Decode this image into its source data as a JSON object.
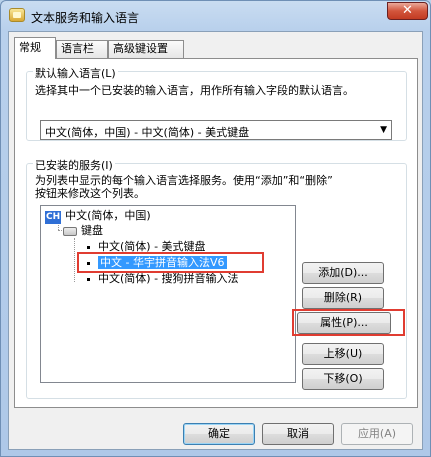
{
  "window": {
    "title": "文本服务和输入语言",
    "close_label": "✕"
  },
  "tabs": [
    {
      "label": "常规",
      "active": true
    },
    {
      "label": "语言栏",
      "active": false
    },
    {
      "label": "高级键设置",
      "active": false
    }
  ],
  "default_language": {
    "group_title": "默认输入语言(L)",
    "description": "选择其中一个已安装的输入语言，用作所有输入字段的默认语言。",
    "selected": "中文(简体，中国) - 中文(简体) - 美式键盘"
  },
  "installed_services": {
    "group_title": "已安装的服务(I)",
    "description_line1": "为列表中显示的每个输入语言选择服务。使用“添加”和“删除”",
    "description_line2": "按钮来修改这个列表。",
    "tree": {
      "language_badge": "CH",
      "language": "中文(简体，中国)",
      "category": "键盘",
      "items": [
        {
          "label": "中文(简体) - 美式键盘",
          "selected": false
        },
        {
          "label": "中文 - 华宇拼音输入法V6",
          "selected": true
        },
        {
          "label": "中文(简体) - 搜狗拼音输入法",
          "selected": false
        }
      ]
    },
    "buttons": {
      "add": "添加(D)...",
      "remove": "删除(R)",
      "properties": "属性(P)...",
      "move_up": "上移(U)",
      "move_down": "下移(O)"
    }
  },
  "footer": {
    "ok": "确定",
    "cancel": "取消",
    "apply": "应用(A)"
  },
  "colors": {
    "highlight": "#e03c31",
    "selection": "#3399ff"
  }
}
